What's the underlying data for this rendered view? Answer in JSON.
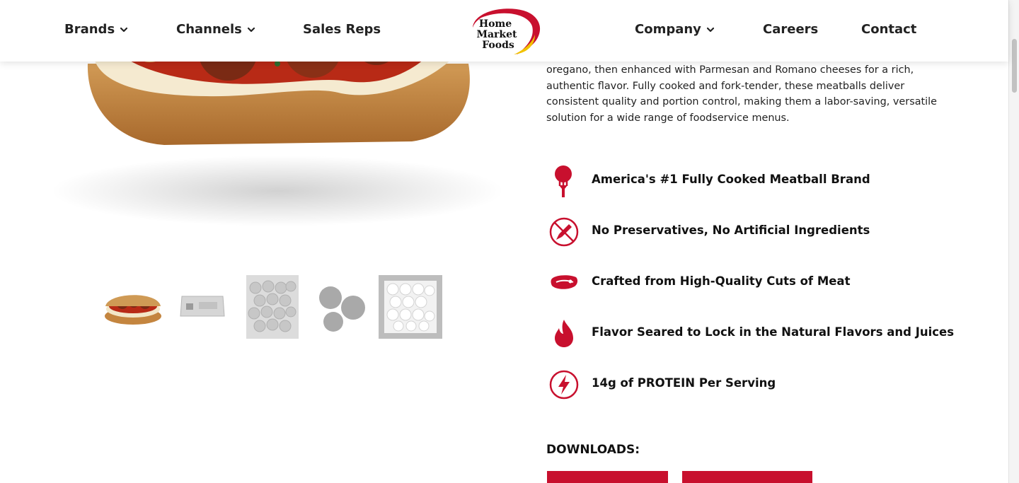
{
  "nav": {
    "left": [
      {
        "label": "Brands",
        "dropdown": true
      },
      {
        "label": "Channels",
        "dropdown": true
      },
      {
        "label": "Sales Reps",
        "dropdown": false
      }
    ],
    "right": [
      {
        "label": "Company",
        "dropdown": true
      },
      {
        "label": "Careers",
        "dropdown": false
      },
      {
        "label": "Contact",
        "dropdown": false
      }
    ],
    "logo": {
      "line1": "Home",
      "line2": "Market",
      "line3": "Foods"
    }
  },
  "description": "oregano, then enhanced with Parmesan and Romano cheeses for a rich, authentic flavor. Fully cooked and fork-tender, these meatballs deliver consistent quality and portion control, making them a labor-saving, versatile solution for a wide range of foodservice menus.",
  "features": [
    {
      "icon": "meatball-fork-icon",
      "label": "America's #1 Fully Cooked Meatball Brand"
    },
    {
      "icon": "no-preservatives-icon",
      "label": "No Preservatives, No Artificial Ingredients"
    },
    {
      "icon": "steak-icon",
      "label": "Crafted from High-Quality Cuts of Meat"
    },
    {
      "icon": "flame-icon",
      "label": "Flavor Seared to Lock in the Natural Flavors and Juices"
    },
    {
      "icon": "lightning-bolt-icon",
      "label": "14g of PROTEIN Per Serving"
    }
  ],
  "downloads": {
    "title": "DOWNLOADS:",
    "buttons": [
      "",
      ""
    ]
  },
  "colors": {
    "brand_red": "#c8102e",
    "brand_yellow": "#f2c200",
    "text_dark": "#111111"
  }
}
